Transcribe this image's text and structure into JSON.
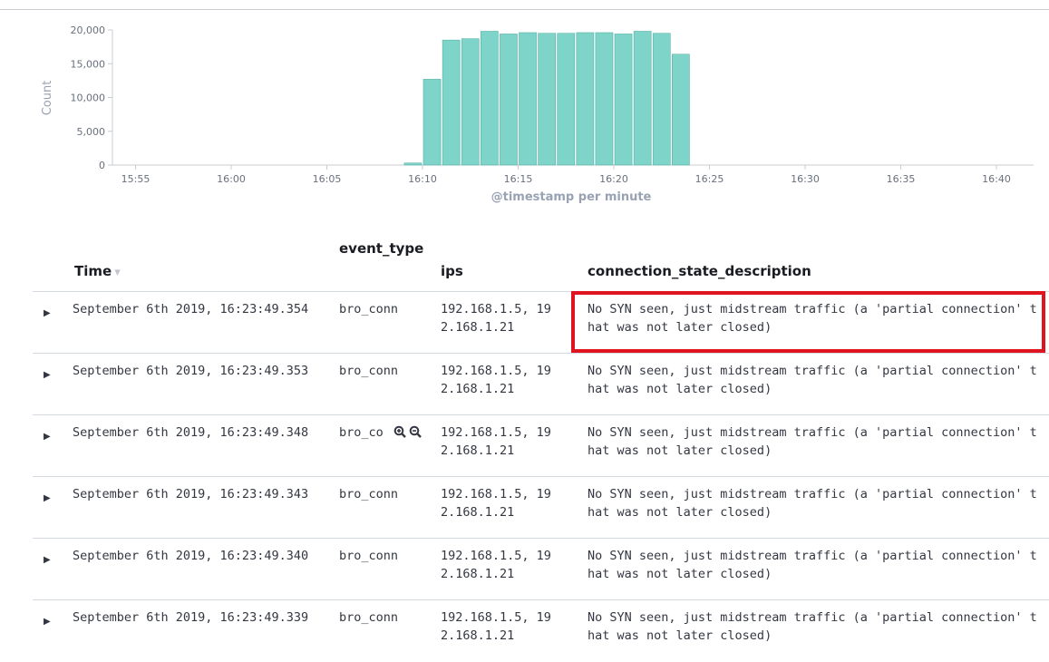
{
  "chart_data": {
    "type": "bar",
    "title": "",
    "xlabel": "@timestamp per minute",
    "ylabel": "Count",
    "ylim": [
      0,
      20000
    ],
    "yticks": [
      "0",
      "5,000",
      "10,000",
      "15,000",
      "20,000"
    ],
    "xticks": [
      "15:55",
      "16:00",
      "16:05",
      "16:10",
      "16:15",
      "16:20",
      "16:25",
      "16:30",
      "16:35",
      "16:40"
    ],
    "categories": [
      "16:09",
      "16:10",
      "16:11",
      "16:12",
      "16:13",
      "16:14",
      "16:15",
      "16:16",
      "16:17",
      "16:18",
      "16:19",
      "16:20",
      "16:21",
      "16:22",
      "16:23"
    ],
    "values": [
      300,
      12700,
      18500,
      18700,
      19800,
      19400,
      19600,
      19500,
      19500,
      19600,
      19600,
      19400,
      19800,
      19500,
      16400
    ],
    "color": "#7fd4c9"
  },
  "table": {
    "columns": {
      "time": "Time",
      "event_type": "event_type",
      "ips": "ips",
      "desc": "connection_state_description"
    },
    "rows": [
      {
        "time": "September 6th 2019, 16:23:49.354",
        "event_type": "bro_conn",
        "ips": "192.168.1.5, 192.168.1.21",
        "desc": "No SYN seen, just midstream traffic (a 'partial connection' that was not later closed)"
      },
      {
        "time": "September 6th 2019, 16:23:49.353",
        "event_type": "bro_conn",
        "ips": "192.168.1.5, 192.168.1.21",
        "desc": "No SYN seen, just midstream traffic (a 'partial connection' that was not later closed)"
      },
      {
        "time": "September 6th 2019, 16:23:49.348",
        "event_type": "bro_co",
        "ips": "192.168.1.5, 192.168.1.21",
        "desc": "No SYN seen, just midstream traffic (a 'partial connection' that was not later closed)"
      },
      {
        "time": "September 6th 2019, 16:23:49.343",
        "event_type": "bro_conn",
        "ips": "192.168.1.5, 192.168.1.21",
        "desc": "No SYN seen, just midstream traffic (a 'partial connection' that was not later closed)"
      },
      {
        "time": "September 6th 2019, 16:23:49.340",
        "event_type": "bro_conn",
        "ips": "192.168.1.5, 192.168.1.21",
        "desc": "No SYN seen, just midstream traffic (a 'partial connection' that was not later closed)"
      },
      {
        "time": "September 6th 2019, 16:23:49.339",
        "event_type": "bro_conn",
        "ips": "192.168.1.5, 192.168.1.21",
        "desc": "No SYN seen, just midstream traffic (a 'partial connection' that was not later closed)"
      }
    ],
    "expand_icon": "caret-right-icon",
    "zoom_in_icon": "magnify-plus-icon",
    "zoom_out_icon": "magnify-minus-icon",
    "highlight_color": "#e0141e"
  }
}
